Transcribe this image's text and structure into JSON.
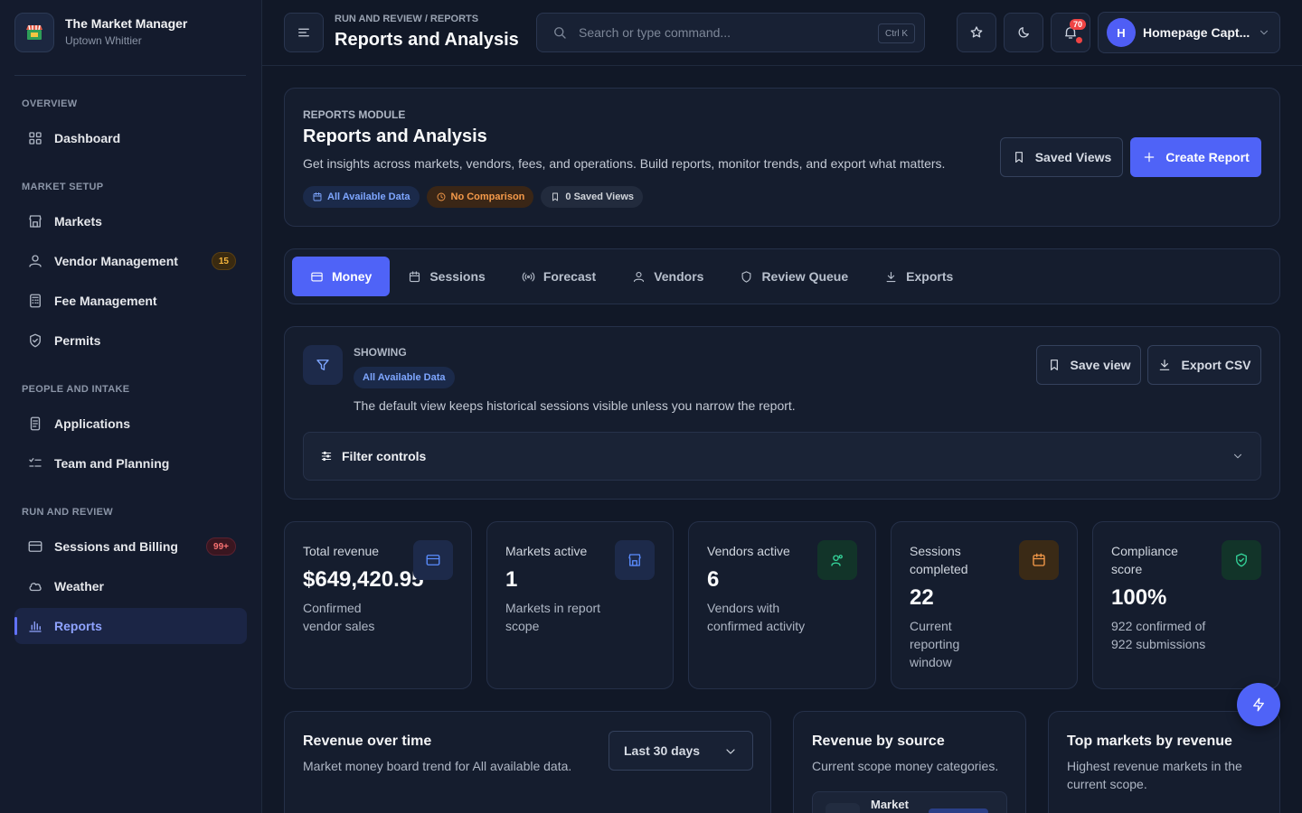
{
  "brand": {
    "title": "The Market Manager",
    "subtitle": "Uptown Whittier"
  },
  "sidebar": {
    "sections": [
      "OVERVIEW",
      "MARKET SETUP",
      "PEOPLE AND INTAKE",
      "RUN AND REVIEW"
    ],
    "items": [
      {
        "label": "Dashboard",
        "icon": "grid-icon"
      },
      {
        "label": "Markets",
        "icon": "store-icon"
      },
      {
        "label": "Vendor Management",
        "icon": "user-icon",
        "badge": "15"
      },
      {
        "label": "Fee Management",
        "icon": "calculator-icon"
      },
      {
        "label": "Permits",
        "icon": "shield-icon"
      },
      {
        "label": "Applications",
        "icon": "document-icon"
      },
      {
        "label": "Team and Planning",
        "icon": "checklist-icon"
      },
      {
        "label": "Sessions and Billing",
        "icon": "wallet-icon",
        "badge": "99+"
      },
      {
        "label": "Weather",
        "icon": "cloud-icon"
      },
      {
        "label": "Reports",
        "icon": "bar-chart-icon",
        "active": true
      }
    ]
  },
  "header": {
    "breadcrumb": "RUN AND REVIEW / REPORTS",
    "title": "Reports and Analysis",
    "search_placeholder": "Search or type command...",
    "search_shortcut": "Ctrl K",
    "notifications_count": "70",
    "user_initial": "H",
    "user_name": "Homepage Capt..."
  },
  "hero": {
    "kicker": "REPORTS MODULE",
    "title": "Reports and Analysis",
    "description": "Get insights across markets, vendors, fees, and operations. Build reports, monitor trends, and export what matters.",
    "chips": [
      "All Available Data",
      "No Comparison",
      "0 Saved Views"
    ],
    "saved_views_label": "Saved Views",
    "create_report_label": "Create Report"
  },
  "tabs": [
    "Money",
    "Sessions",
    "Forecast",
    "Vendors",
    "Review Queue",
    "Exports"
  ],
  "filters": {
    "showing_label": "SHOWING",
    "scope_chip": "All Available Data",
    "description": "The default view keeps historical sessions visible unless you narrow the report.",
    "save_view_label": "Save view",
    "export_csv_label": "Export CSV",
    "controls_label": "Filter controls"
  },
  "kpis": [
    {
      "label": "Total revenue",
      "value": "$649,420.95",
      "desc": "Confirmed vendor sales",
      "color": "#5b8dff"
    },
    {
      "label": "Markets active",
      "value": "1",
      "desc": "Markets in report scope",
      "color": "#5b8dff"
    },
    {
      "label": "Vendors active",
      "value": "6",
      "desc": "Vendors with confirmed activity",
      "color": "#34d399"
    },
    {
      "label": "Sessions completed",
      "value": "22",
      "desc": "Current reporting window",
      "color": "#f59a4a"
    },
    {
      "label": "Compliance score",
      "value": "100%",
      "desc": "922 confirmed of 922 submissions",
      "color": "#34d399"
    }
  ],
  "sections": {
    "revenue_over_time": {
      "title": "Revenue over time",
      "subtitle": "Market money board trend for All available data.",
      "range": "Last 30 days"
    },
    "revenue_by_source": {
      "title": "Revenue by source",
      "subtitle": "Current scope money categories.",
      "first_row": "Market"
    },
    "top_markets": {
      "title": "Top markets by revenue",
      "subtitle": "Highest revenue markets in the current scope."
    }
  }
}
